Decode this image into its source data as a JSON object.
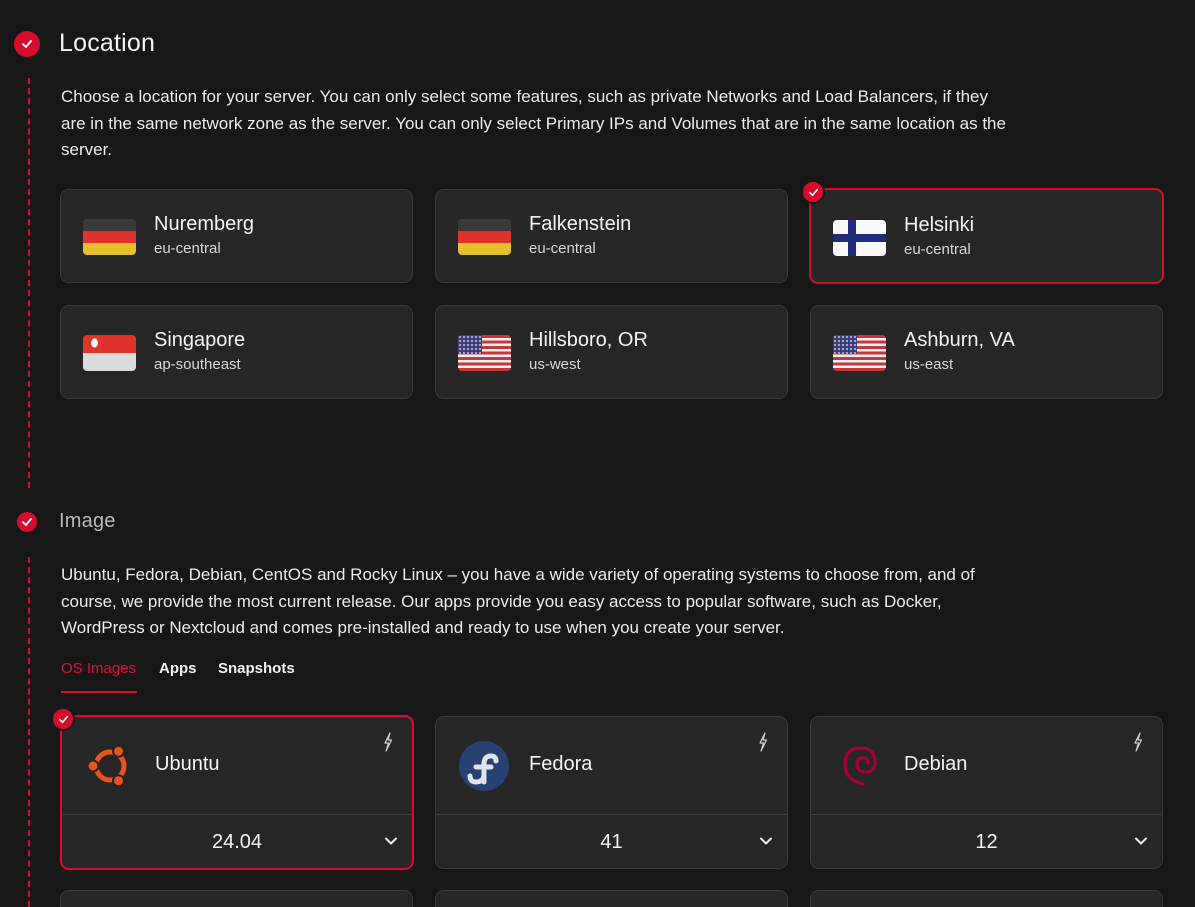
{
  "location": {
    "title": "Location",
    "description": "Choose a location for your server. You can only select some features, such as private Networks and Load Balancers, if they are in the same network zone as the server. You can only select Primary IPs and Volumes that are in the same location as the server.",
    "cards": [
      {
        "name": "Nuremberg",
        "zone": "eu-central",
        "flag": "germany-flag"
      },
      {
        "name": "Falkenstein",
        "zone": "eu-central",
        "flag": "germany-flag"
      },
      {
        "name": "Helsinki",
        "zone": "eu-central",
        "flag": "finland-flag",
        "selected": true
      },
      {
        "name": "Singapore",
        "zone": "ap-southeast",
        "flag": "singapore-flag"
      },
      {
        "name": "Hillsboro, OR",
        "zone": "us-west",
        "flag": "usa-flag"
      },
      {
        "name": "Ashburn, VA",
        "zone": "us-east",
        "flag": "usa-flag"
      }
    ]
  },
  "image": {
    "title": "Image",
    "description": "Ubuntu, Fedora, Debian, CentOS and Rocky Linux – you have a wide variety of operating systems to choose from, and of course, we provide the most current release. Our apps provide you easy access to popular software, such as Docker, WordPress or Nextcloud and comes pre-installed and ready to use when you create your server.",
    "tabs": [
      {
        "label": "OS Images",
        "active": true
      },
      {
        "label": "Apps"
      },
      {
        "label": "Snapshots"
      }
    ],
    "os_cards": [
      {
        "name": "Ubuntu",
        "version": "24.04",
        "logo": "ubuntu-logo-icon",
        "selected": true
      },
      {
        "name": "Fedora",
        "version": "41",
        "logo": "fedora-logo-icon"
      },
      {
        "name": "Debian",
        "version": "12",
        "logo": "debian-logo-icon"
      }
    ]
  },
  "colors": {
    "accent": "#d50c2d",
    "background": "#171717",
    "card": "#262626"
  }
}
